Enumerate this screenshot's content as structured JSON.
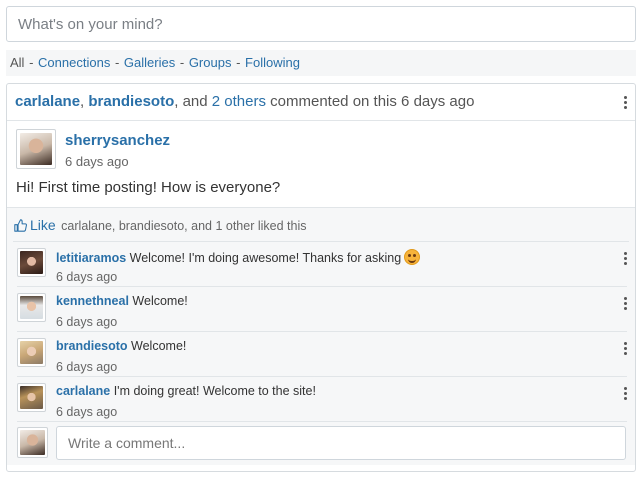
{
  "status": {
    "placeholder": "What's on your mind?"
  },
  "filters": {
    "all": "All",
    "separator": "-",
    "items": [
      "Connections",
      "Galleries",
      "Groups",
      "Following"
    ]
  },
  "activity": {
    "user1": "carlalane",
    "comma": ",",
    "user2": "brandiesoto",
    "and": ", and",
    "others_link": "2 others",
    "suffix": "commented on this 6 days ago"
  },
  "post": {
    "author": "sherrysanchez",
    "time": "6 days ago",
    "text": "Hi! First time posting! How is everyone?"
  },
  "likes": {
    "like_label": "Like",
    "summary": "carlalane, brandiesoto, and 1 other liked this"
  },
  "comments": [
    {
      "user": "letitiaramos",
      "text": "Welcome! I'm doing awesome! Thanks for asking",
      "time": "6 days ago",
      "emoji": "smiley"
    },
    {
      "user": "kennethneal",
      "text": "Welcome!",
      "time": "6 days ago"
    },
    {
      "user": "brandiesoto",
      "text": "Welcome!",
      "time": "6 days ago"
    },
    {
      "user": "carlalane",
      "text": "I'm doing great! Welcome to the site!",
      "time": "6 days ago"
    }
  ],
  "comment_box": {
    "placeholder": "Write a comment..."
  },
  "colors": {
    "link": "#2a70a8",
    "muted": "#666666",
    "panel": "#f6f7f8"
  }
}
